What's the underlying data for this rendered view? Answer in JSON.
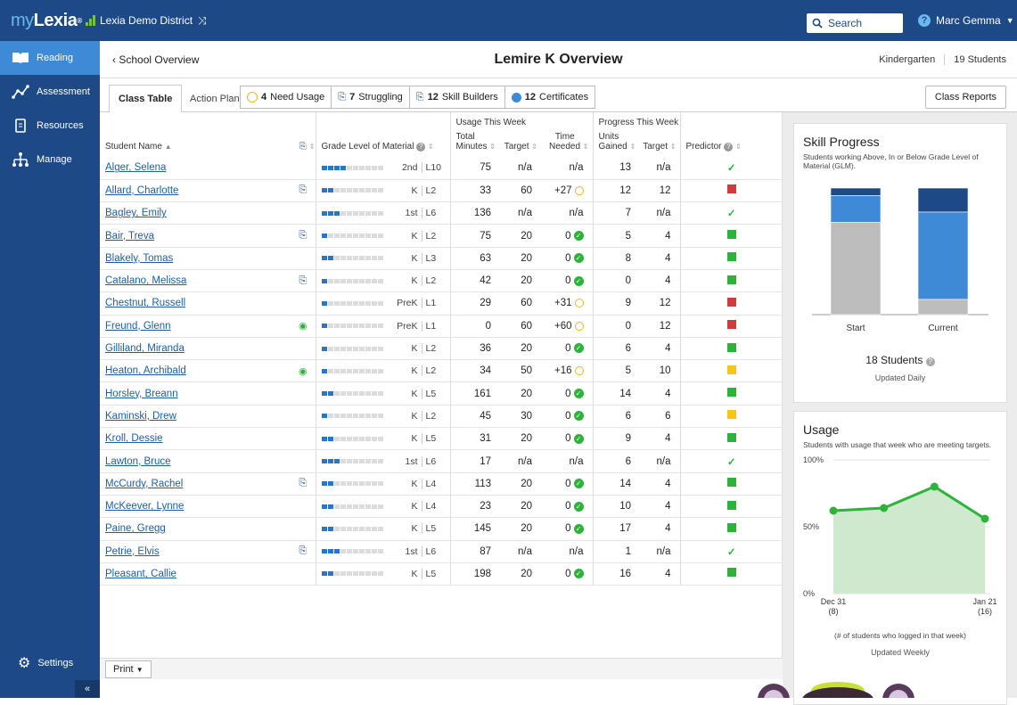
{
  "topbar": {
    "logo_my": "my",
    "logo_lexia": "Lexia",
    "logo_reg": "®",
    "district": "Lexia Demo District",
    "search_label": "Search",
    "user_name": "Marc Gemma"
  },
  "sidebar": {
    "items": [
      {
        "label": "Reading",
        "icon": "book-icon"
      },
      {
        "label": "Assessment",
        "icon": "chart-line-icon"
      },
      {
        "label": "Resources",
        "icon": "document-icon"
      },
      {
        "label": "Manage",
        "icon": "hierarchy-icon"
      }
    ],
    "settings_label": "Settings",
    "collapse_label": "«"
  },
  "header": {
    "back_label": "School Overview",
    "title": "Lemire K Overview",
    "grade": "Kindergarten",
    "students": "19 Students"
  },
  "toolbar": {
    "tab_label": "Class Table",
    "action_plan_label": "Action Plan:",
    "buttons": [
      {
        "count": "4",
        "label": "Need Usage"
      },
      {
        "count": "7",
        "label": "Struggling"
      },
      {
        "count": "12",
        "label": "Skill Builders"
      },
      {
        "count": "12",
        "label": "Certificates"
      }
    ],
    "reports_label": "Class Reports"
  },
  "table": {
    "group_usage": "Usage This Week",
    "group_progress": "Progress This Week",
    "col_name": "Student Name",
    "col_glm": "Grade Level of Material",
    "col_total1": "Total",
    "col_total2": "Minutes",
    "col_target": "Target",
    "col_time1": "Time",
    "col_time2": "Needed",
    "col_units1": "Units",
    "col_units2": "Gained",
    "col_target2": "Target",
    "col_predictor": "Predictor",
    "rows": [
      {
        "name": "Alger, Selena",
        "plan": "",
        "fill": 4,
        "grade": "2nd",
        "level": "L10",
        "minutes": "75",
        "target": "n/a",
        "needed": "n/a",
        "needed_status": "none",
        "units": "13",
        "utarget": "n/a",
        "pred": "check"
      },
      {
        "name": "Allard, Charlotte",
        "plan": "struggling",
        "fill": 2,
        "grade": "K",
        "level": "L2",
        "minutes": "33",
        "target": "60",
        "needed": "+27",
        "needed_status": "clock",
        "units": "12",
        "utarget": "12",
        "pred": "red"
      },
      {
        "name": "Bagley, Emily",
        "plan": "",
        "fill": 3,
        "grade": "1st",
        "level": "L6",
        "minutes": "136",
        "target": "n/a",
        "needed": "n/a",
        "needed_status": "none",
        "units": "7",
        "utarget": "n/a",
        "pred": "check"
      },
      {
        "name": "Bair, Treva",
        "plan": "struggling",
        "fill": 1,
        "grade": "K",
        "level": "L2",
        "minutes": "75",
        "target": "20",
        "needed": "0",
        "needed_status": "done",
        "units": "5",
        "utarget": "4",
        "pred": "green"
      },
      {
        "name": "Blakely, Tomas",
        "plan": "",
        "fill": 2,
        "grade": "K",
        "level": "L3",
        "minutes": "63",
        "target": "20",
        "needed": "0",
        "needed_status": "done",
        "units": "8",
        "utarget": "4",
        "pred": "green"
      },
      {
        "name": "Catalano, Melissa",
        "plan": "struggling",
        "fill": 1,
        "grade": "K",
        "level": "L2",
        "minutes": "42",
        "target": "20",
        "needed": "0",
        "needed_status": "done",
        "units": "0",
        "utarget": "4",
        "pred": "green"
      },
      {
        "name": "Chestnut, Russell",
        "plan": "",
        "fill": 1,
        "grade": "PreK",
        "level": "L1",
        "minutes": "29",
        "target": "60",
        "needed": "+31",
        "needed_status": "clock",
        "units": "9",
        "utarget": "12",
        "pred": "red"
      },
      {
        "name": "Freund, Glenn",
        "plan": "certificate",
        "fill": 1,
        "grade": "PreK",
        "level": "L1",
        "minutes": "0",
        "target": "60",
        "needed": "+60",
        "needed_status": "clock",
        "units": "0",
        "utarget": "12",
        "pred": "red"
      },
      {
        "name": "Gilliland, Miranda",
        "plan": "",
        "fill": 1,
        "grade": "K",
        "level": "L2",
        "minutes": "36",
        "target": "20",
        "needed": "0",
        "needed_status": "done",
        "units": "6",
        "utarget": "4",
        "pred": "green"
      },
      {
        "name": "Heaton, Archibald",
        "plan": "certificate",
        "fill": 1,
        "grade": "K",
        "level": "L2",
        "minutes": "34",
        "target": "50",
        "needed": "+16",
        "needed_status": "clock",
        "units": "5",
        "utarget": "10",
        "pred": "yellow"
      },
      {
        "name": "Horsley, Breann",
        "plan": "",
        "fill": 2,
        "grade": "K",
        "level": "L5",
        "minutes": "161",
        "target": "20",
        "needed": "0",
        "needed_status": "done",
        "units": "14",
        "utarget": "4",
        "pred": "green"
      },
      {
        "name": "Kaminski, Drew",
        "plan": "",
        "fill": 1,
        "grade": "K",
        "level": "L2",
        "minutes": "45",
        "target": "30",
        "needed": "0",
        "needed_status": "done",
        "units": "6",
        "utarget": "6",
        "pred": "yellow"
      },
      {
        "name": "Kroll, Dessie",
        "plan": "",
        "fill": 2,
        "grade": "K",
        "level": "L5",
        "minutes": "31",
        "target": "20",
        "needed": "0",
        "needed_status": "done",
        "units": "9",
        "utarget": "4",
        "pred": "green"
      },
      {
        "name": "Lawton, Bruce",
        "plan": "",
        "fill": 3,
        "grade": "1st",
        "level": "L6",
        "minutes": "17",
        "target": "n/a",
        "needed": "n/a",
        "needed_status": "none",
        "units": "6",
        "utarget": "n/a",
        "pred": "check"
      },
      {
        "name": "McCurdy, Rachel",
        "plan": "struggling",
        "fill": 2,
        "grade": "K",
        "level": "L4",
        "minutes": "113",
        "target": "20",
        "needed": "0",
        "needed_status": "done",
        "units": "14",
        "utarget": "4",
        "pred": "green"
      },
      {
        "name": "McKeever, Lynne",
        "plan": "",
        "fill": 2,
        "grade": "K",
        "level": "L4",
        "minutes": "23",
        "target": "20",
        "needed": "0",
        "needed_status": "done",
        "units": "10",
        "utarget": "4",
        "pred": "green"
      },
      {
        "name": "Paine, Gregg",
        "plan": "",
        "fill": 2,
        "grade": "K",
        "level": "L5",
        "minutes": "145",
        "target": "20",
        "needed": "0",
        "needed_status": "done",
        "units": "17",
        "utarget": "4",
        "pred": "green"
      },
      {
        "name": "Petrie, Elvis",
        "plan": "struggling",
        "fill": 3,
        "grade": "1st",
        "level": "L6",
        "minutes": "87",
        "target": "n/a",
        "needed": "n/a",
        "needed_status": "none",
        "units": "1",
        "utarget": "n/a",
        "pred": "check"
      },
      {
        "name": "Pleasant, Callie",
        "plan": "",
        "fill": 2,
        "grade": "K",
        "level": "L5",
        "minutes": "198",
        "target": "20",
        "needed": "0",
        "needed_status": "done",
        "units": "16",
        "utarget": "4",
        "pred": "green"
      }
    ]
  },
  "footer": {
    "print_label": "Print"
  },
  "skill_progress": {
    "title": "Skill Progress",
    "subtitle": "Students working Above, In or Below Grade Level of Material (GLM).",
    "students": "18 Students",
    "updated": "Updated Daily"
  },
  "usage": {
    "title": "Usage",
    "subtitle": "Students with usage that week who are meeting targets.",
    "updated": "Updated Weekly",
    "note": "(# of students who logged in that week)"
  },
  "chart_data": [
    {
      "type": "bar",
      "stacked": true,
      "categories": [
        "Start",
        "Current"
      ],
      "series": [
        {
          "values": [
            0.06,
            0.19
          ],
          "color": "#1d4a86"
        },
        {
          "values": [
            0.21,
            0.69
          ],
          "color": "#3e8ad6"
        },
        {
          "values": [
            0.73,
            0.12
          ],
          "color": "#bdbdbd"
        }
      ]
    },
    {
      "type": "area",
      "x": [
        "Dec 31",
        "",
        "",
        "Jan 21"
      ],
      "x_sub": [
        "(8)",
        "",
        "",
        "(16)"
      ],
      "values": [
        62,
        64,
        80,
        56
      ],
      "ylim": [
        0,
        100
      ],
      "yticks": [
        "0%",
        "50%",
        "100%"
      ],
      "color": "#2eb33a"
    }
  ],
  "colors": {
    "brand": "#1d4a86",
    "accent": "#3e8ad6",
    "green": "#2eb33a",
    "red": "#d23b3b",
    "yellow": "#f5c518"
  }
}
